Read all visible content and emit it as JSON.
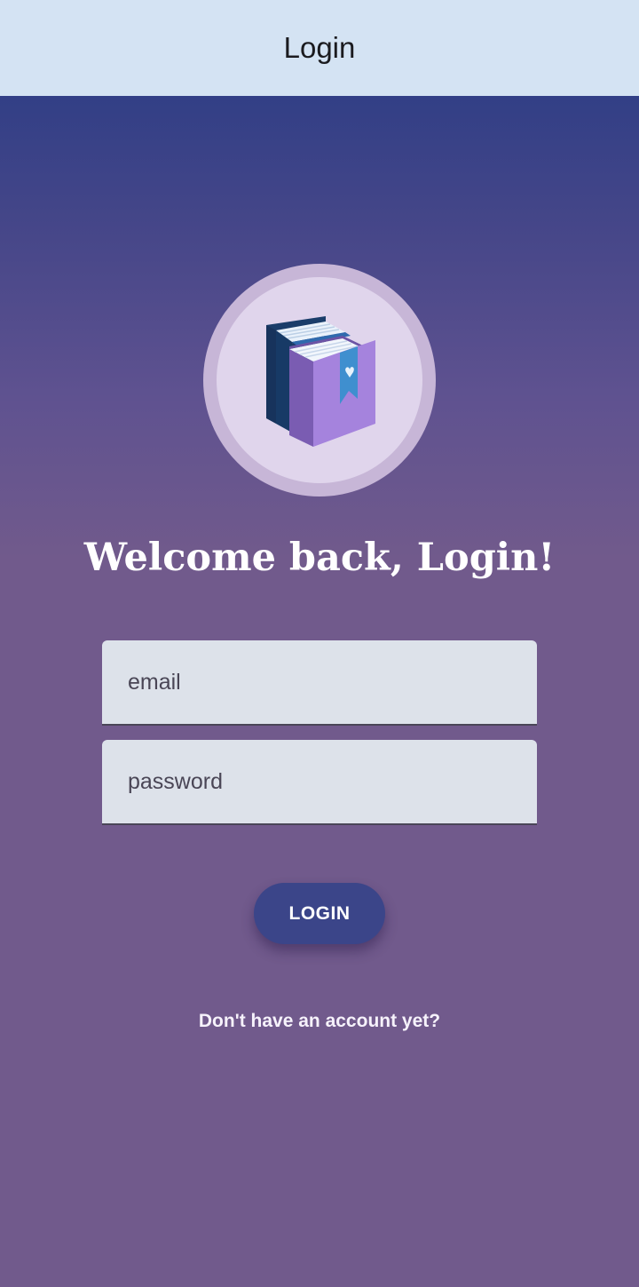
{
  "app_bar": {
    "title": "Login"
  },
  "logo": {
    "icon": "books-icon"
  },
  "welcome": {
    "text": "Welcome back, Login!"
  },
  "form": {
    "email_placeholder": "email",
    "password_placeholder": "password",
    "login_label": "LOGIN"
  },
  "signup": {
    "link_text": "Don't have an account yet?"
  },
  "colors": {
    "app_bar": "#d4e3f3",
    "gradient_top": "#323f86",
    "gradient_bottom": "#715a8c",
    "field_background": "#dde2ea",
    "button": "#3b4589"
  }
}
